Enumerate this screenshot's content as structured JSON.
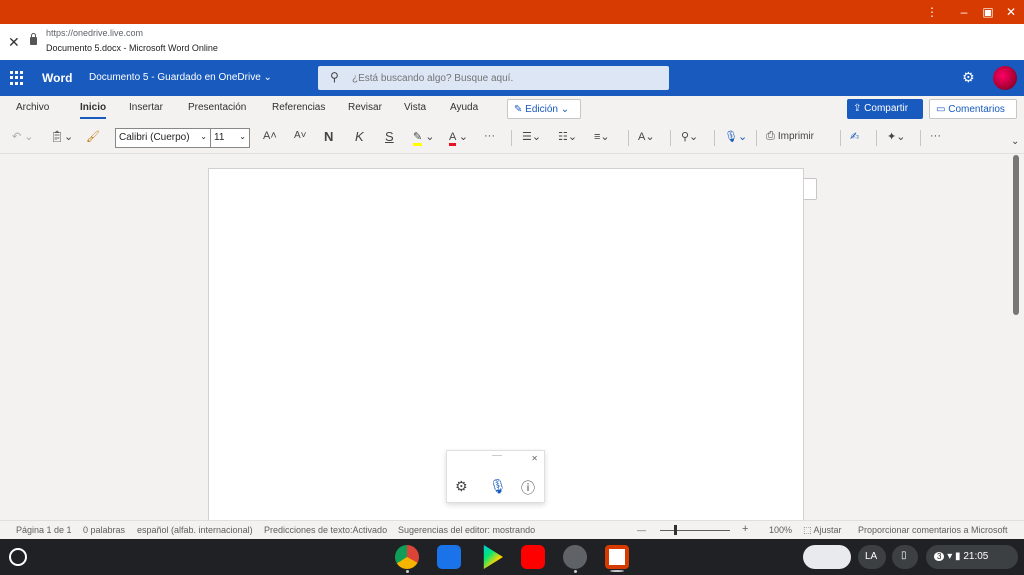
{
  "browser": {
    "url": "https://onedrive.live.com",
    "title": "Documento 5.docx - Microsoft Word Online",
    "menu_icon": "kebab-menu-icon",
    "close_icon": "close-icon"
  },
  "app": {
    "name": "Word",
    "doc_title": "Documento 5  -  Guardado en OneDrive ⌄",
    "search_placeholder": "¿Está buscando algo? Busque aquí.",
    "brand_color": "#185abd",
    "titlebar_color": "#d83b01"
  },
  "menu": {
    "items": [
      "Archivo",
      "Inicio",
      "Insertar",
      "Presentación",
      "Referencias",
      "Revisar",
      "Vista",
      "Ayuda"
    ],
    "active": "Inicio",
    "edit_label": "Edición",
    "share_label": "Compartir",
    "comments_label": "Comentarios"
  },
  "toolbar": {
    "font_name": "Calibri (Cuerpo)",
    "font_size": "11",
    "grow_font": "A˄",
    "shrink_font": "A˅",
    "bold": "N",
    "italic": "K",
    "underline": "S",
    "font_color_letter": "A",
    "more": "···",
    "print_label": "Imprimir",
    "more2": "···"
  },
  "status": {
    "page": "Página 1 de 1",
    "words": "0 palabras",
    "language": "español (alfab. internacional)",
    "predictions": "Predicciones de texto:Activado",
    "suggestions": "Sugerencias del editor: mostrando",
    "zoom_minus": "—",
    "zoom_plus": "+",
    "zoom": "100%",
    "fit": "Ajustar",
    "feedback": "Proporcionar comentarios a Microsoft"
  },
  "shelf": {
    "keyboard": "LA",
    "notif_count": "3",
    "time": "21:05"
  }
}
